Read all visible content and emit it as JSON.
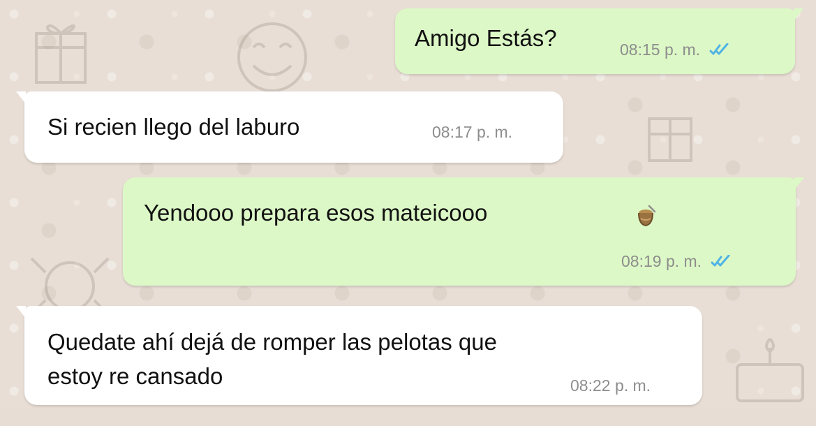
{
  "colors": {
    "background": "#e8ded5",
    "outgoing_bubble": "#dcf8c6",
    "incoming_bubble": "#ffffff",
    "timestamp": "#8d8d8d",
    "read_receipt": "#4fb3e6"
  },
  "messages": [
    {
      "direction": "outgoing",
      "text": "Amigo Estás?",
      "time": "08:15 p. m.",
      "status_icon": "double-check-read-icon"
    },
    {
      "direction": "incoming",
      "text": "Si recien llego del laburo",
      "time": "08:17 p. m."
    },
    {
      "direction": "outgoing",
      "text": "Yendooo prepara esos mateicooo",
      "emoji_icon": "mate-icon",
      "time": "08:19 p. m.",
      "status_icon": "double-check-read-icon"
    },
    {
      "direction": "incoming",
      "text_lines": [
        "Quedate ahí dejá de romper las pelotas que",
        "estoy re cansado"
      ],
      "time": "08:22 p. m."
    }
  ]
}
